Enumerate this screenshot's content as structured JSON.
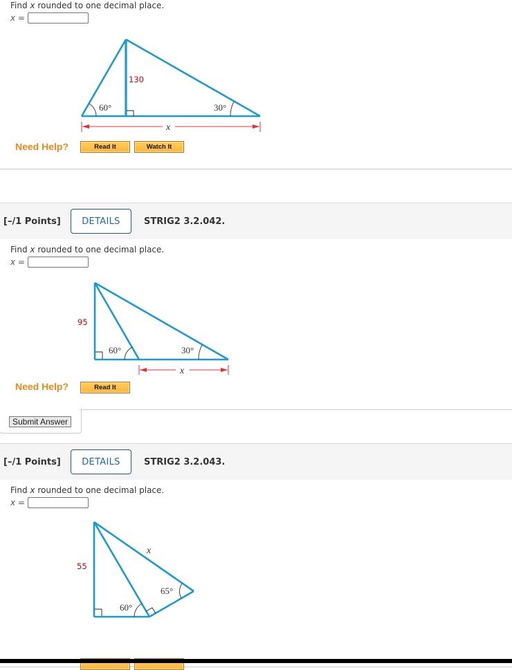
{
  "colors": {
    "diagram_line": "#1c9ad6",
    "measure_arrow": "#e8303a",
    "side_label": "#d00000",
    "need_help": "#f0881a",
    "details_text": "#1d6aa0",
    "header_bg": "#f5f5f5"
  },
  "problems": [
    {
      "prompt_prefix": "Find ",
      "prompt_var": "x",
      "prompt_suffix": " rounded to one decimal place.",
      "answer_label_var": "x",
      "answer_label_eq": " =",
      "answer_value": "",
      "diagram": {
        "side_label": "130",
        "angle_left": "60°",
        "angle_right": "30°",
        "unknown_label": "x"
      },
      "need_help": "Need Help?",
      "help_buttons": [
        "Read It",
        "Watch It"
      ]
    },
    {
      "points": "[–/1 Points]",
      "details_label": "DETAILS",
      "question_id": "STRIG2 3.2.042.",
      "prompt_prefix": "Find ",
      "prompt_var": "x",
      "prompt_suffix": " rounded to one decimal place.",
      "answer_label_var": "x",
      "answer_label_eq": " =",
      "answer_value": "",
      "diagram": {
        "side_label": "95",
        "angle_left": "60°",
        "angle_right": "30°",
        "unknown_label": "x"
      },
      "need_help": "Need Help?",
      "help_buttons": [
        "Read It"
      ],
      "submit_label": "Submit Answer"
    },
    {
      "points": "[–/1 Points]",
      "details_label": "DETAILS",
      "question_id": "STRIG2 3.2.043.",
      "prompt_prefix": "Find ",
      "prompt_var": "x",
      "prompt_suffix": " rounded to one decimal place.",
      "answer_label_var": "x",
      "answer_label_eq": " =",
      "answer_value": "",
      "diagram": {
        "side_label": "55",
        "angle_bottom": "60°",
        "angle_right": "65°",
        "unknown_label": "x"
      }
    }
  ]
}
